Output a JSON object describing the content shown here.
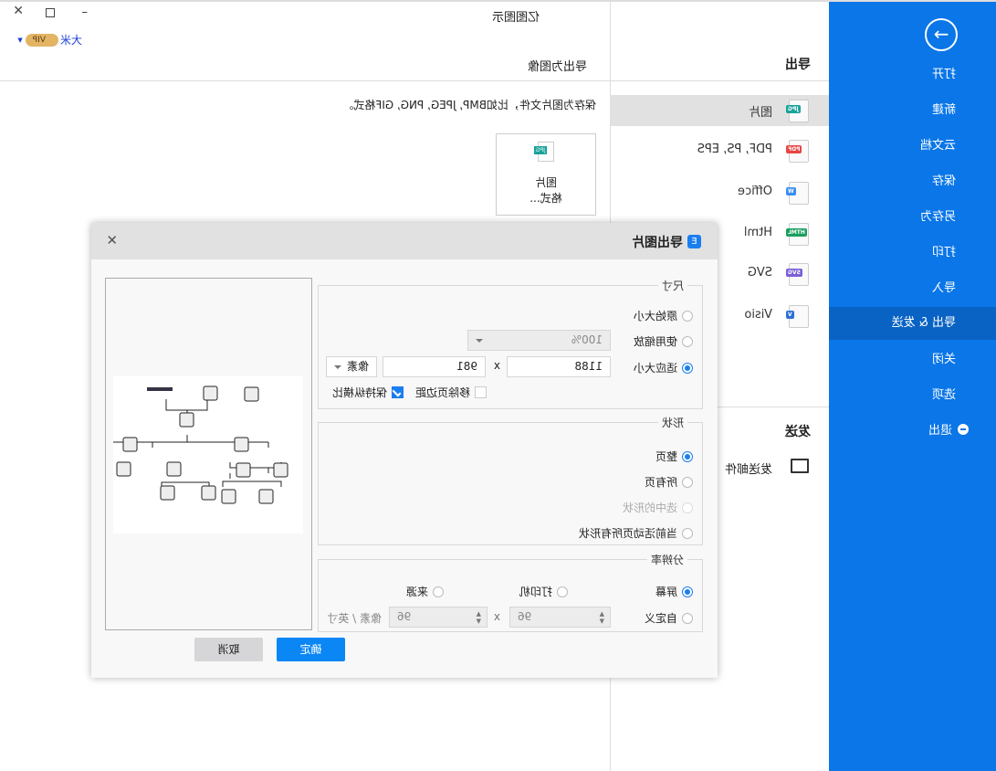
{
  "app": {
    "title": "亿图图示",
    "user": "大米",
    "vip": "VIP"
  },
  "sidebar": {
    "items": [
      {
        "label": "打开"
      },
      {
        "label": "新建"
      },
      {
        "label": "云文档"
      },
      {
        "label": "保存"
      },
      {
        "label": "另存为"
      },
      {
        "label": "打印"
      },
      {
        "label": "导入"
      },
      {
        "label": "导出 & 发送",
        "active": true
      },
      {
        "label": "关闭"
      },
      {
        "label": "选项"
      },
      {
        "label": "退出"
      }
    ],
    "accent": "#0a76e8"
  },
  "export": {
    "title": "导出",
    "formats": [
      {
        "label": "图片",
        "badge": "JPG",
        "color": "#1aa39a"
      },
      {
        "label": "PDF, PS, EPS",
        "badge": "PDF",
        "color": "#e84545"
      },
      {
        "label": "Office",
        "badge": "W",
        "color": "#3b8ef0"
      },
      {
        "label": "Html",
        "badge": "HTML",
        "color": "#1a9f5e"
      },
      {
        "label": "SVG",
        "badge": "SVG",
        "color": "#7b5fd6"
      },
      {
        "label": "Visio",
        "badge": "V",
        "color": "#2f6fd6"
      }
    ],
    "send_title": "发送",
    "send_mail": "发送邮件"
  },
  "content": {
    "title": "导出为图像",
    "description": "保存为图片文件，比如BMP, JPEG, PNG, GIF格式。",
    "card_line1": "图片",
    "card_line2": "格式..."
  },
  "dialog": {
    "title": "导出图片",
    "size": {
      "legend": "尺寸",
      "original": "原始大小",
      "scale": "使用缩放",
      "scale_value": "100%",
      "fit": "适应大小",
      "width": "1188",
      "x": "x",
      "height": "981",
      "unit": "像素",
      "remove_margin": "移除页边距",
      "remove_margin_checked": false,
      "keep_ratio": "保持纵横比",
      "keep_ratio_checked": true,
      "selected": "fit"
    },
    "shape": {
      "legend": "形状",
      "options": [
        "整页",
        "所有页",
        "选中的形状",
        "当前活动页所有形状"
      ],
      "selected": "整页"
    },
    "resolution": {
      "legend": "分辨率",
      "screen": "屏幕",
      "printer": "打印机",
      "source": "来源",
      "custom": "自定义",
      "dpi_x": "96",
      "x": "x",
      "dpi_y": "96",
      "unit": "像素 / 英寸",
      "selected": "屏幕"
    },
    "ok": "确定",
    "cancel": "取消"
  }
}
